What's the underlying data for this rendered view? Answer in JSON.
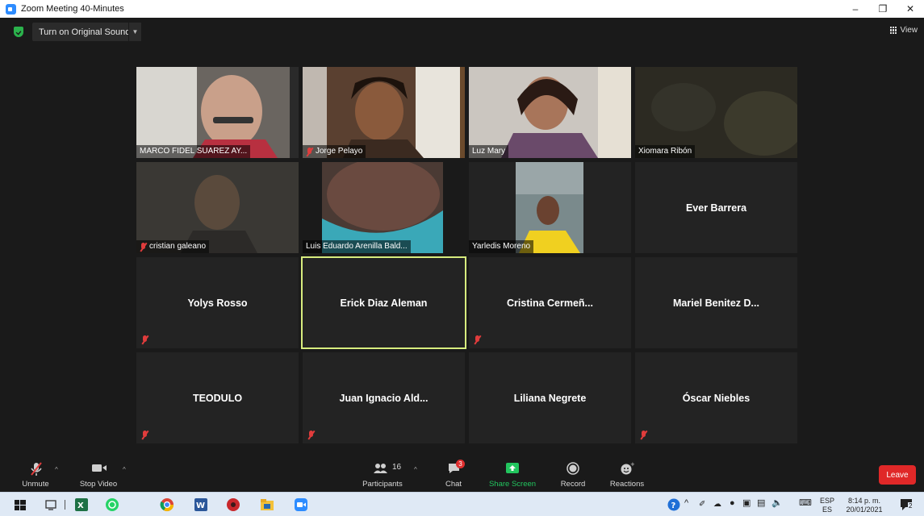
{
  "window": {
    "title": "Zoom Meeting 40-Minutes",
    "minimize_icon": "minimize-icon",
    "restore_icon": "restore-icon",
    "close_icon": "close-icon"
  },
  "topbar": {
    "original_sound_label": "Turn on Original Sound",
    "view_label": "View"
  },
  "participants_grid": [
    {
      "name": "MARCO FIDEL SUAREZ AY...",
      "video": true,
      "muted": false
    },
    {
      "name": "Jorge Pelayo",
      "video": true,
      "muted": true
    },
    {
      "name": "Luz Mary",
      "video": true,
      "muted": false
    },
    {
      "name": "Xiomara Ribón",
      "video": true,
      "muted": false
    },
    {
      "name": "cristian galeano",
      "video": true,
      "muted": true
    },
    {
      "name": "Luis Eduardo Arenilla Bald...",
      "video": true,
      "muted": false
    },
    {
      "name": "Yarledis Moreno",
      "video": true,
      "muted": false
    },
    {
      "name": "Ever Barrera",
      "video": false,
      "muted": false
    },
    {
      "name": "Yolys Rosso",
      "video": false,
      "muted": true
    },
    {
      "name": "Erick Diaz Aleman",
      "video": false,
      "muted": false,
      "active_speaker": true
    },
    {
      "name": "Cristina Cermeñ...",
      "video": false,
      "muted": true
    },
    {
      "name": "Mariel Benitez D...",
      "video": false,
      "muted": false
    },
    {
      "name": "TEODULO",
      "video": false,
      "muted": true
    },
    {
      "name": "Juan Ignacio Ald...",
      "video": false,
      "muted": true
    },
    {
      "name": "Liliana Negrete",
      "video": false,
      "muted": false
    },
    {
      "name": "Óscar Niebles",
      "video": false,
      "muted": true
    }
  ],
  "toolbar": {
    "unmute_label": "Unmute",
    "stop_video_label": "Stop Video",
    "participants_label": "Participants",
    "participants_count": "16",
    "chat_label": "Chat",
    "chat_badge": "3",
    "share_screen_label": "Share Screen",
    "record_label": "Record",
    "reactions_label": "Reactions",
    "leave_label": "Leave"
  },
  "taskbar": {
    "language_top": "ESP",
    "language_bottom": "ES",
    "time": "8:14 p. m.",
    "date": "20/01/2021",
    "notification_count": "2"
  },
  "colors": {
    "accent": "#2d8cff",
    "share_green": "#22c55e",
    "leave_red": "#e02828",
    "active_border": "#d7ec7e"
  }
}
